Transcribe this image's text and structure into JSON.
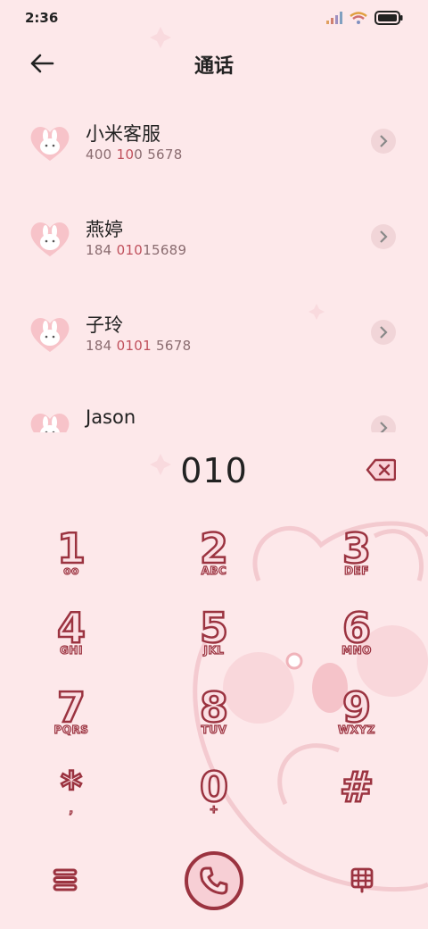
{
  "status": {
    "time": "2:36"
  },
  "header": {
    "title": "通话"
  },
  "contacts": [
    {
      "name": "小米客服",
      "num_parts": [
        "400 ",
        "10",
        "0 5678"
      ],
      "highlight": "010"
    },
    {
      "name": "燕婷",
      "num_parts": [
        "184 ",
        "010",
        "15689"
      ]
    },
    {
      "name": "子玲",
      "num_parts": [
        "184 ",
        "0101",
        " 5678"
      ]
    },
    {
      "name": "Jason",
      "num_parts": [
        "",
        "",
        ""
      ]
    }
  ],
  "dialer": {
    "input": "010"
  },
  "keys": [
    {
      "digit": "1",
      "letters": "oo"
    },
    {
      "digit": "2",
      "letters": "ABC"
    },
    {
      "digit": "3",
      "letters": "DEF"
    },
    {
      "digit": "4",
      "letters": "GHI"
    },
    {
      "digit": "5",
      "letters": "JKL"
    },
    {
      "digit": "6",
      "letters": "MNO"
    },
    {
      "digit": "7",
      "letters": "PQRS"
    },
    {
      "digit": "8",
      "letters": "TUV"
    },
    {
      "digit": "9",
      "letters": "WXYZ"
    },
    {
      "digit": "*",
      "letters": ","
    },
    {
      "digit": "0",
      "letters": "+"
    },
    {
      "digit": "#",
      "letters": ""
    }
  ],
  "colors": {
    "accent": "#9b3340",
    "background": "#fde8ea"
  },
  "icons": {
    "back": "back-arrow-icon",
    "delete": "backspace-icon",
    "call": "phone-icon",
    "menu": "menu-icon",
    "grid": "keypad-icon"
  }
}
